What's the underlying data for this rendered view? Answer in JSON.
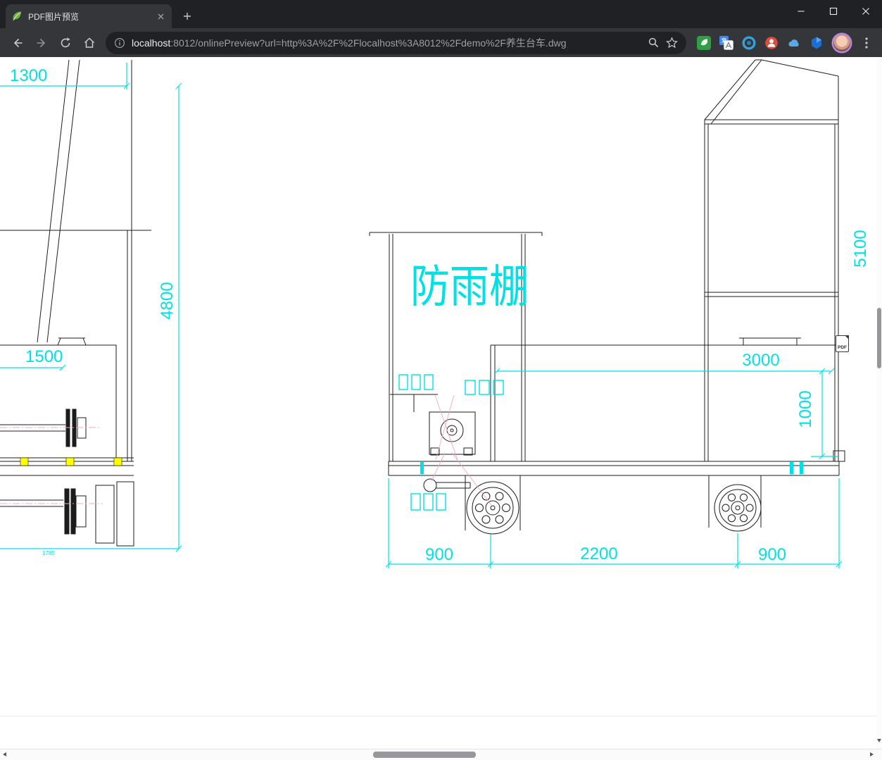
{
  "browser": {
    "tab_title": "PDF图片预览",
    "url_host": "localhost",
    "url_rest": ":8012/onlinePreview?url=http%3A%2F%2Flocalhost%3A8012%2Fdemo%2F养生台车.dwg"
  },
  "drawing": {
    "shelter_label": "防雨棚",
    "dims": {
      "d1300": "1300",
      "d4800": "4800",
      "d1500": "1500",
      "d1785": "1785",
      "d5100": "5100",
      "d3000": "3000",
      "d1000": "1000",
      "d900_left": "900",
      "d2200": "2200",
      "d900_right": "900"
    },
    "pdf_badge": "PDF",
    "colors": {
      "dimension_cyan": "#00E1E6",
      "line_black": "#1C1C1C",
      "highlight_yellow": "#FFFF00",
      "centerline_pink": "#F0A8BA"
    }
  }
}
